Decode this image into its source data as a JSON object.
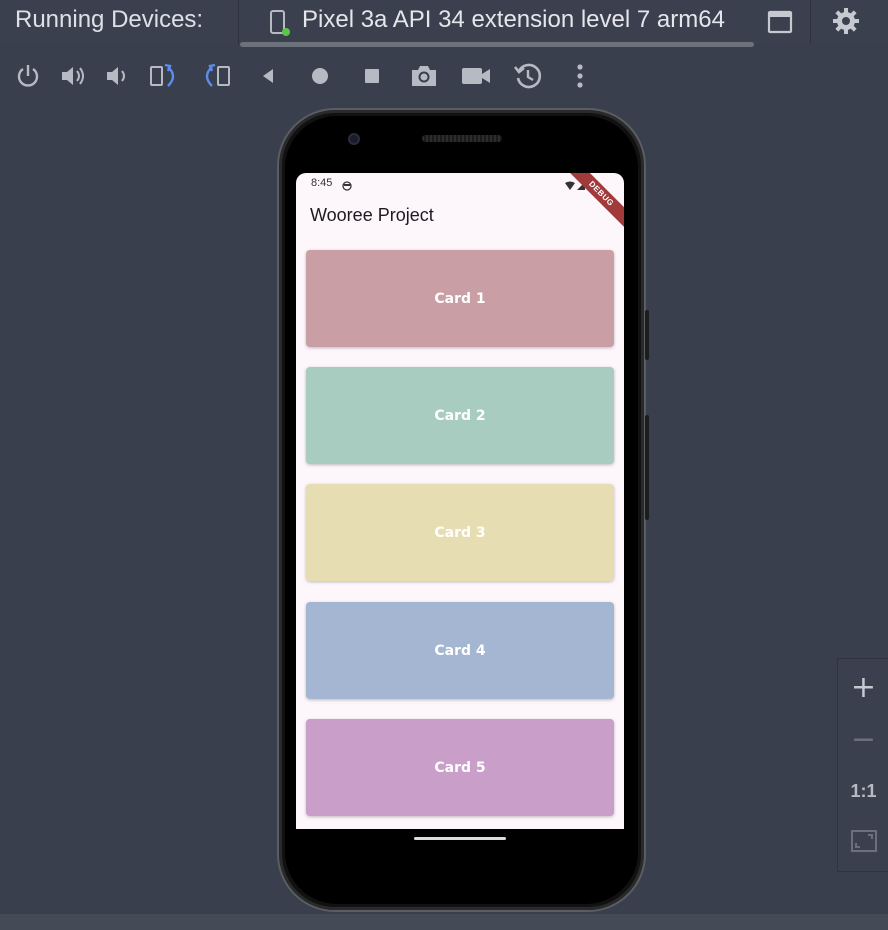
{
  "header": {
    "title": "Running Devices:",
    "tab_label": "Pixel 3a API 34 extension level 7 arm64"
  },
  "toolbar": {
    "icons": [
      "power-icon",
      "volume-up-icon",
      "volume-down-icon",
      "rotate-left-icon",
      "rotate-right-icon",
      "back-icon",
      "home-icon",
      "overview-icon",
      "screenshot-icon",
      "screen-record-icon",
      "snapshot-icon",
      "more-icon"
    ]
  },
  "device": {
    "status_time": "8:45",
    "debug_banner": "DEBUG",
    "app_title": "Wooree Project",
    "cards": [
      {
        "label": "Card 1",
        "color": "#c99ea4"
      },
      {
        "label": "Card 2",
        "color": "#a9ccc1"
      },
      {
        "label": "Card 3",
        "color": "#e7ddb3"
      },
      {
        "label": "Card 4",
        "color": "#a5b6d3"
      },
      {
        "label": "Card 5",
        "color": "#c99ec9"
      }
    ]
  },
  "zoom": {
    "zoom_in": "+",
    "zoom_out": "−",
    "actual_size": "1:1"
  },
  "colors": {
    "background": "#3a3f4d",
    "accent_blue": "#5b8def",
    "icon_gray": "#b6bac3"
  }
}
